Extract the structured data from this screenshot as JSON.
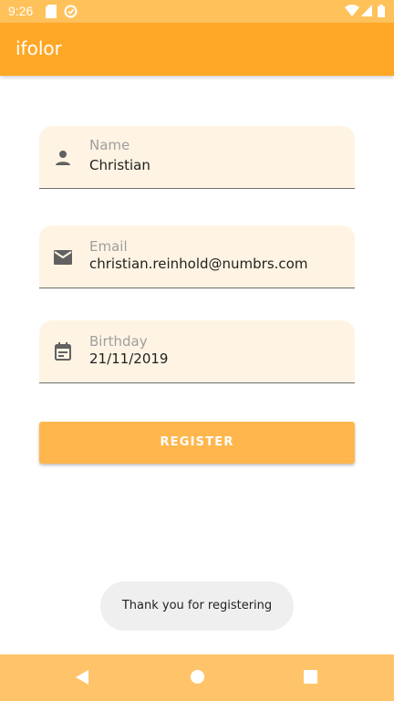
{
  "status_bar": {
    "time": "9:26"
  },
  "app_bar": {
    "title": "ifolor"
  },
  "form": {
    "name": {
      "label": "Name",
      "value": "Christian",
      "icon": "person-icon"
    },
    "email": {
      "label": "Email",
      "value": "christian.reinhold@numbrs.com",
      "icon": "mail-icon"
    },
    "birthday": {
      "label": "Birthday",
      "value": "21/11/2019",
      "icon": "calendar-icon"
    }
  },
  "register_button": {
    "label": "REGISTER"
  },
  "toast": {
    "message": "Thank you for registering"
  },
  "colors": {
    "app_bar": "#ffa726",
    "status_bar": "#ffc15a",
    "field_background": "#fff4e3",
    "button": "#ffb74d",
    "nav_bar": "#ffc46a"
  }
}
